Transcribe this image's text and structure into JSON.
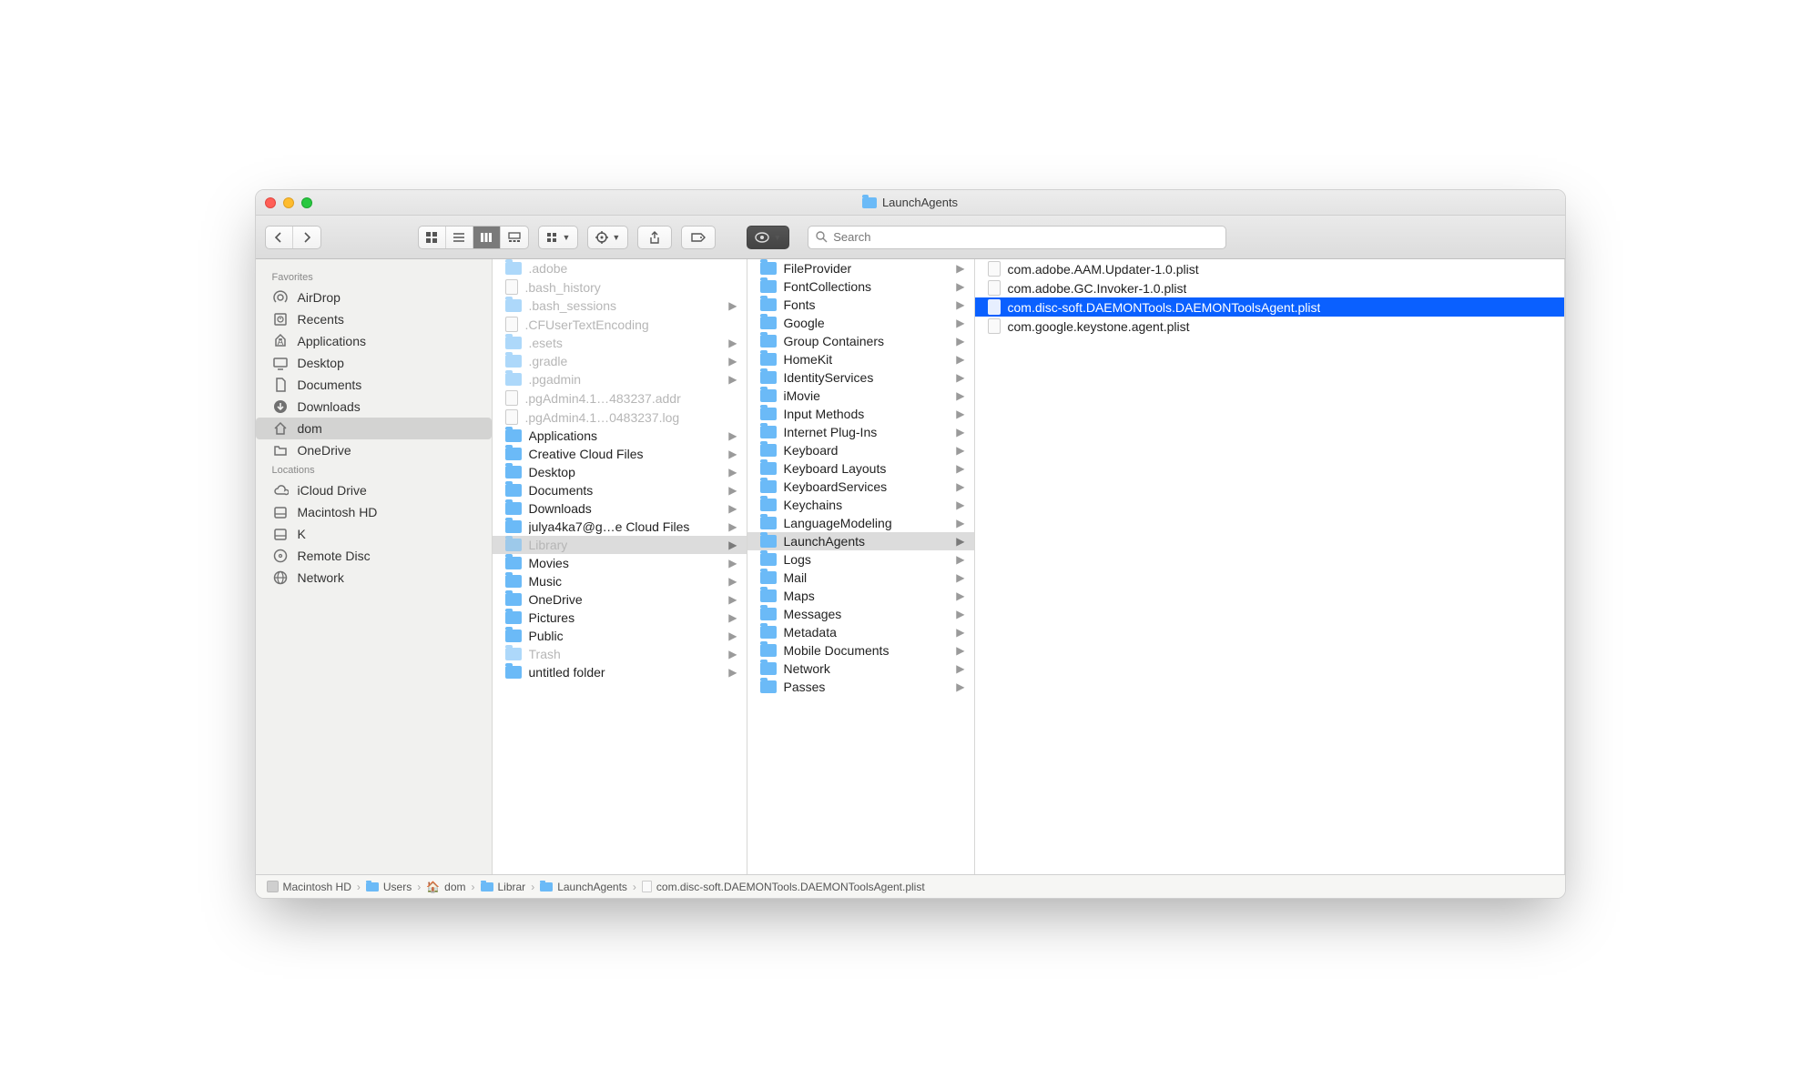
{
  "window_title": "LaunchAgents",
  "search": {
    "placeholder": "Search"
  },
  "sidebar": {
    "sections": [
      {
        "header": "Favorites",
        "items": [
          {
            "label": "AirDrop",
            "icon": "airdrop",
            "selected": false
          },
          {
            "label": "Recents",
            "icon": "recents",
            "selected": false
          },
          {
            "label": "Applications",
            "icon": "applications",
            "selected": false
          },
          {
            "label": "Desktop",
            "icon": "desktop",
            "selected": false
          },
          {
            "label": "Documents",
            "icon": "documents",
            "selected": false
          },
          {
            "label": "Downloads",
            "icon": "downloads",
            "selected": false
          },
          {
            "label": "dom",
            "icon": "home",
            "selected": true
          },
          {
            "label": "OneDrive",
            "icon": "folder",
            "selected": false
          }
        ]
      },
      {
        "header": "Locations",
        "items": [
          {
            "label": "iCloud Drive",
            "icon": "cloud",
            "selected": false
          },
          {
            "label": "Macintosh HD",
            "icon": "disk",
            "selected": false
          },
          {
            "label": "K",
            "icon": "disk",
            "selected": false
          },
          {
            "label": "Remote Disc",
            "icon": "disc",
            "selected": false
          },
          {
            "label": "Network",
            "icon": "network",
            "selected": false
          }
        ]
      }
    ]
  },
  "columns": [
    {
      "items": [
        {
          "label": ".adobe",
          "type": "folder",
          "dim": true,
          "expandable": false
        },
        {
          "label": ".bash_history",
          "type": "file",
          "dim": true
        },
        {
          "label": ".bash_sessions",
          "type": "folder",
          "dim": true,
          "expandable": true
        },
        {
          "label": ".CFUserTextEncoding",
          "type": "file",
          "dim": true
        },
        {
          "label": ".esets",
          "type": "folder",
          "dim": true,
          "expandable": true
        },
        {
          "label": ".gradle",
          "type": "folder",
          "dim": true,
          "expandable": true
        },
        {
          "label": ".pgadmin",
          "type": "folder",
          "dim": true,
          "expandable": true
        },
        {
          "label": ".pgAdmin4.1…483237.addr",
          "type": "file",
          "dim": true
        },
        {
          "label": ".pgAdmin4.1…0483237.log",
          "type": "file",
          "dim": true
        },
        {
          "label": "Applications",
          "type": "folder",
          "expandable": true
        },
        {
          "label": "Creative Cloud Files",
          "type": "folder",
          "expandable": true
        },
        {
          "label": "Desktop",
          "type": "folder",
          "expandable": true
        },
        {
          "label": "Documents",
          "type": "folder",
          "expandable": true
        },
        {
          "label": "Downloads",
          "type": "folder",
          "expandable": true
        },
        {
          "label": "julya4ka7@g…e Cloud Files",
          "type": "folder",
          "expandable": true
        },
        {
          "label": "Library",
          "type": "folder",
          "expandable": true,
          "selected": true,
          "dim": true
        },
        {
          "label": "Movies",
          "type": "folder",
          "expandable": true
        },
        {
          "label": "Music",
          "type": "folder",
          "expandable": true
        },
        {
          "label": "OneDrive",
          "type": "folder",
          "expandable": true
        },
        {
          "label": "Pictures",
          "type": "folder",
          "expandable": true
        },
        {
          "label": "Public",
          "type": "folder",
          "expandable": true
        },
        {
          "label": "Trash",
          "type": "folder",
          "dim": true,
          "expandable": true
        },
        {
          "label": "untitled folder",
          "type": "folder",
          "expandable": true
        }
      ]
    },
    {
      "items": [
        {
          "label": "FileProvider",
          "type": "folder",
          "expandable": true
        },
        {
          "label": "FontCollections",
          "type": "folder",
          "expandable": true
        },
        {
          "label": "Fonts",
          "type": "folder",
          "expandable": true
        },
        {
          "label": "Google",
          "type": "folder",
          "expandable": true
        },
        {
          "label": "Group Containers",
          "type": "folder",
          "expandable": true
        },
        {
          "label": "HomeKit",
          "type": "folder",
          "expandable": true
        },
        {
          "label": "IdentityServices",
          "type": "folder",
          "expandable": true
        },
        {
          "label": "iMovie",
          "type": "folder",
          "expandable": true
        },
        {
          "label": "Input Methods",
          "type": "folder",
          "expandable": true
        },
        {
          "label": "Internet Plug-Ins",
          "type": "folder",
          "expandable": true
        },
        {
          "label": "Keyboard",
          "type": "folder",
          "expandable": true
        },
        {
          "label": "Keyboard Layouts",
          "type": "folder",
          "expandable": true
        },
        {
          "label": "KeyboardServices",
          "type": "folder",
          "expandable": true
        },
        {
          "label": "Keychains",
          "type": "folder",
          "expandable": true
        },
        {
          "label": "LanguageModeling",
          "type": "folder",
          "expandable": true
        },
        {
          "label": "LaunchAgents",
          "type": "folder",
          "expandable": true,
          "selected": true
        },
        {
          "label": "Logs",
          "type": "folder",
          "expandable": true
        },
        {
          "label": "Mail",
          "type": "folder",
          "expandable": true
        },
        {
          "label": "Maps",
          "type": "folder",
          "expandable": true
        },
        {
          "label": "Messages",
          "type": "folder",
          "expandable": true
        },
        {
          "label": "Metadata",
          "type": "folder",
          "expandable": true
        },
        {
          "label": "Mobile Documents",
          "type": "folder",
          "expandable": true
        },
        {
          "label": "Network",
          "type": "folder",
          "expandable": true
        },
        {
          "label": "Passes",
          "type": "folder",
          "expandable": true
        }
      ]
    },
    {
      "items": [
        {
          "label": "com.adobe.AAM.Updater-1.0.plist",
          "type": "file"
        },
        {
          "label": "com.adobe.GC.Invoker-1.0.plist",
          "type": "file"
        },
        {
          "label": "com.disc-soft.DAEMONTools.DAEMONToolsAgent.plist",
          "type": "file",
          "highlight": true
        },
        {
          "label": "com.google.keystone.agent.plist",
          "type": "file"
        }
      ]
    }
  ],
  "path": [
    {
      "label": "Macintosh HD",
      "icon": "disk"
    },
    {
      "label": "Users",
      "icon": "folder"
    },
    {
      "label": "dom",
      "icon": "home"
    },
    {
      "label": "Librar",
      "icon": "folder"
    },
    {
      "label": "LaunchAgents",
      "icon": "folder"
    },
    {
      "label": "com.disc-soft.DAEMONTools.DAEMONToolsAgent.plist",
      "icon": "file"
    }
  ]
}
